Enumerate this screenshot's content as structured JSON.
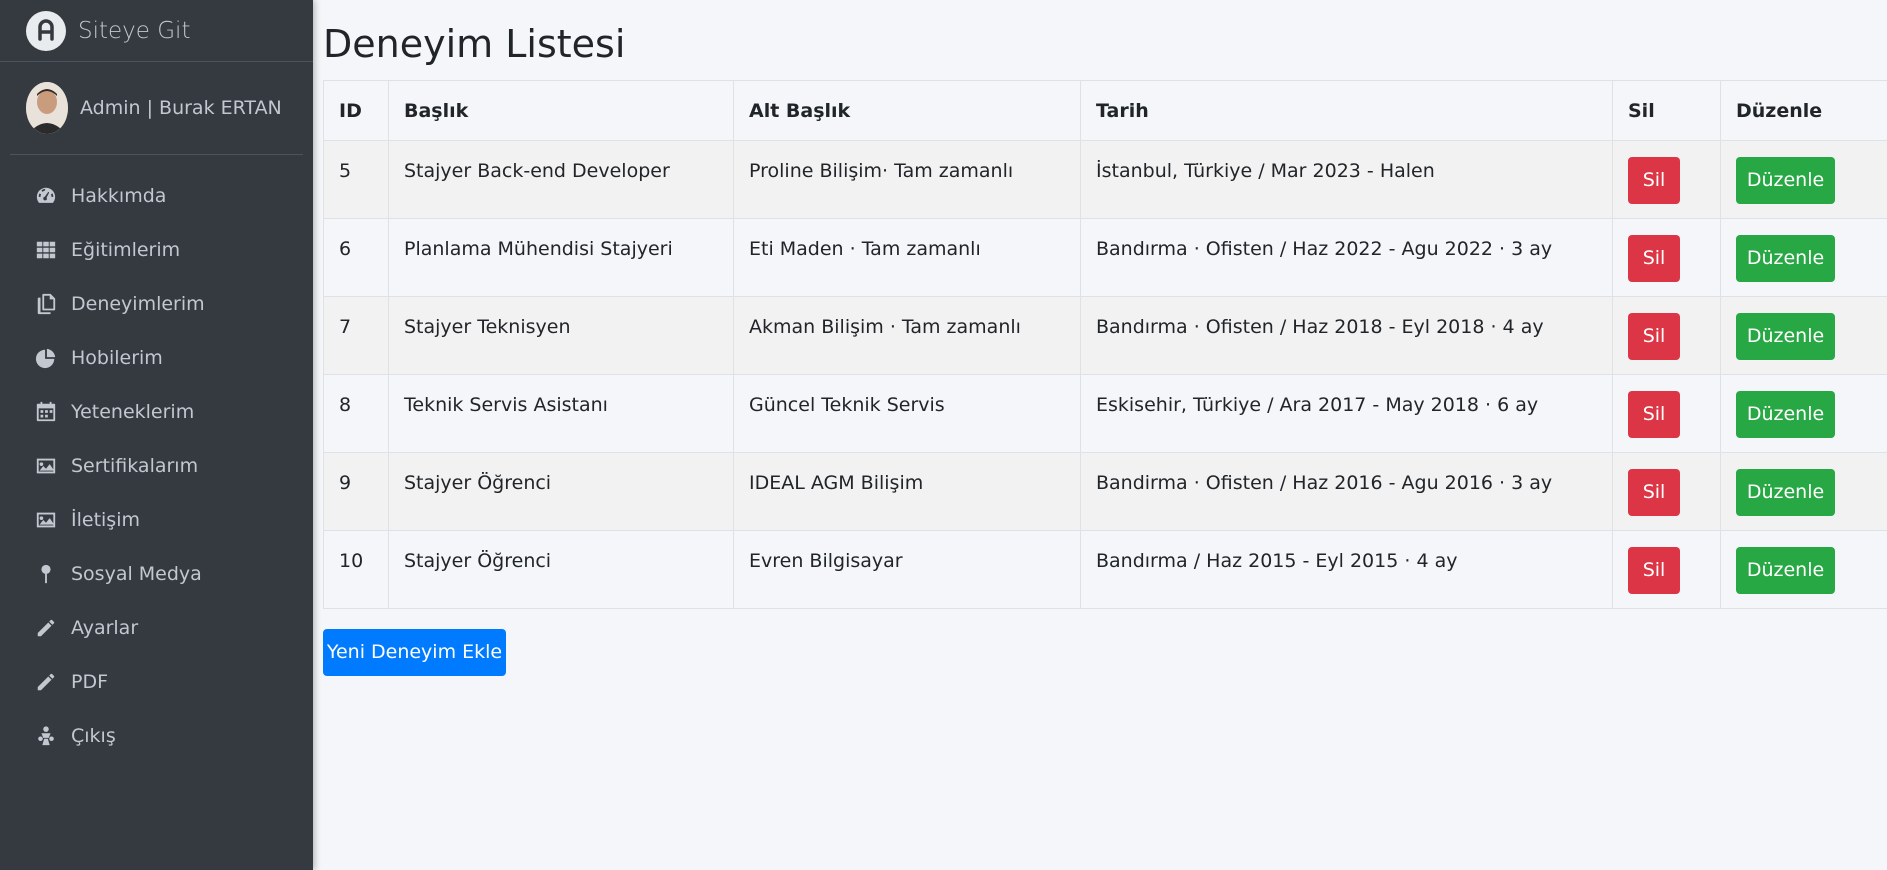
{
  "brand": {
    "text": "Siteye Git"
  },
  "user": {
    "name": "Admin | Burak ERTAN"
  },
  "sidebar": {
    "items": [
      {
        "label": "Hakkımda",
        "icon": "gauge-icon"
      },
      {
        "label": "Eğitimlerim",
        "icon": "grid-icon"
      },
      {
        "label": "Deneyimlerim",
        "icon": "copy-icon"
      },
      {
        "label": "Hobilerim",
        "icon": "pie-chart-icon"
      },
      {
        "label": "Yeteneklerim",
        "icon": "calendar-icon"
      },
      {
        "label": "Sertifikalarım",
        "icon": "image-icon"
      },
      {
        "label": "İletişim",
        "icon": "image-icon"
      },
      {
        "label": "Sosyal Medya",
        "icon": "map-pin-icon"
      },
      {
        "label": "Ayarlar",
        "icon": "pencil-icon"
      },
      {
        "label": "PDF",
        "icon": "pencil-icon"
      },
      {
        "label": "Çıkış",
        "icon": "user-group-icon"
      }
    ]
  },
  "page": {
    "title": "Deneyim Listesi"
  },
  "table": {
    "headers": [
      "ID",
      "Başlık",
      "Alt Başlık",
      "Tarih",
      "Sil",
      "Düzenle"
    ],
    "rows": [
      {
        "id": "5",
        "baslik": "Stajyer Back-end Developer",
        "alt": "Proline Bilişim· Tam zamanlı",
        "tarih": "İstanbul, Türkiye / Mar 2023 - Halen"
      },
      {
        "id": "6",
        "baslik": "Planlama Mühendisi Stajyeri",
        "alt": "Eti Maden · Tam zamanlı",
        "tarih": "Bandırma · Ofisten / Haz 2022 - Agu 2022 · 3 ay"
      },
      {
        "id": "7",
        "baslik": "Stajyer Teknisyen",
        "alt": "Akman Bilişim · Tam zamanlı",
        "tarih": "Bandırma · Ofisten / Haz 2018 - Eyl 2018 · 4 ay"
      },
      {
        "id": "8",
        "baslik": "Teknik Servis Asistanı",
        "alt": "Güncel Teknik Servis",
        "tarih": "Eskisehir, Türkiye / Ara 2017 - May 2018 · 6 ay"
      },
      {
        "id": "9",
        "baslik": "Stajyer Öğrenci",
        "alt": "IDEAL AGM Bilişim",
        "tarih": "Bandirma · Ofisten / Haz 2016 - Agu 2016 · 3 ay"
      },
      {
        "id": "10",
        "baslik": "Stajyer Öğrenci",
        "alt": "Evren Bilgisayar",
        "tarih": "Bandırma / Haz 2015 - Eyl 2015 · 4 ay"
      }
    ],
    "delete_label": "Sil",
    "edit_label": "Düzenle"
  },
  "actions": {
    "add_label": "Yeni Deneyim Ekle"
  },
  "colors": {
    "sidebar": "#343a40",
    "danger": "#dc3545",
    "success": "#28a745",
    "primary": "#007bff"
  }
}
